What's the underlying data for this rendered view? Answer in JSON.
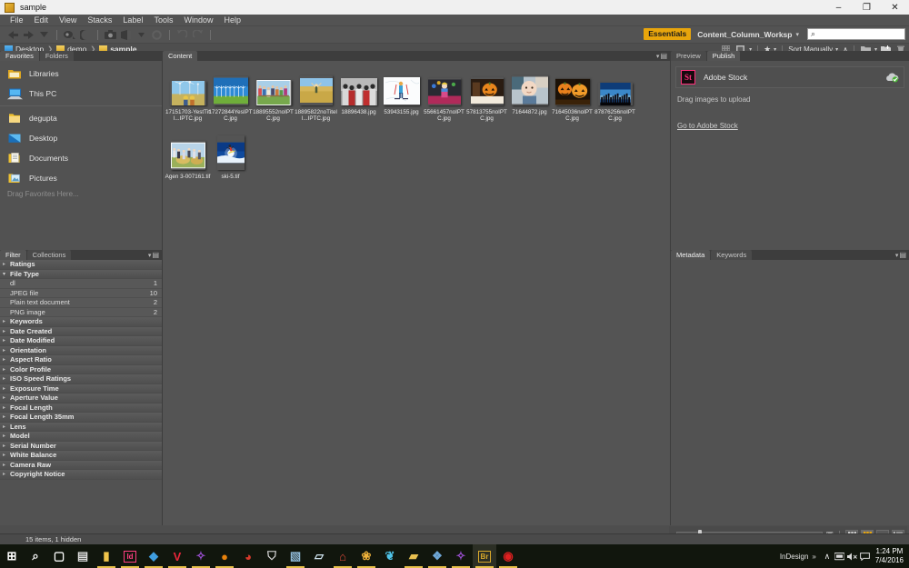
{
  "window": {
    "title": "sample",
    "app_icon": "bridge-app-icon",
    "minimize": "–",
    "maximize": "❐",
    "close": "✕"
  },
  "menubar": {
    "items": [
      "File",
      "Edit",
      "View",
      "Stacks",
      "Label",
      "Tools",
      "Window",
      "Help"
    ]
  },
  "toolbar": {
    "icons": [
      {
        "name": "back-arrow-icon",
        "glyph": "◀"
      },
      {
        "name": "forward-arrow-icon",
        "glyph": "▶"
      },
      {
        "name": "recent-dropdown-icon",
        "glyph": "▼"
      },
      {
        "name": "boomerang-reveal-icon",
        "glyph": "◔"
      },
      {
        "name": "refine-icon",
        "glyph": "☾"
      },
      {
        "name": "camera-import-icon",
        "glyph": "▣"
      },
      {
        "name": "open-in-camera-raw-icon",
        "glyph": "◧"
      },
      {
        "name": "refresh-icon",
        "glyph": "↻"
      },
      {
        "name": "rotate-ccw-icon",
        "glyph": "↶"
      },
      {
        "name": "rotate-cw-icon",
        "glyph": "↷"
      }
    ],
    "workspace_chip": "Essentials",
    "workspace_name": "Content_Column_Worksp",
    "workspace_caret": "▾",
    "search_placeholder": "",
    "search_value": "",
    "search_icon": "⌕"
  },
  "pathbar": {
    "crumbs": [
      {
        "label": "Desktop",
        "icon": "desktop-folder-icon"
      },
      {
        "label": "demo",
        "icon": "folder-icon"
      },
      {
        "label": "sample",
        "icon": "folder-icon"
      }
    ],
    "separator": "❯",
    "sort_label": "Sort Manually",
    "sort_caret": "▾",
    "sort_direction": "∧",
    "star_label": "★",
    "new_folder": "▤",
    "delete": "Ὕ1"
  },
  "favorites": {
    "tabs": [
      {
        "label": "Favorites",
        "active": true
      },
      {
        "label": "Folders",
        "active": false
      }
    ],
    "group_a": [
      {
        "label": "Libraries",
        "icon": "libraries-icon"
      },
      {
        "label": "This PC",
        "icon": "this-pc-icon"
      }
    ],
    "group_b": [
      {
        "label": "degupta",
        "icon": "user-folder-icon"
      },
      {
        "label": "Desktop",
        "icon": "desktop-icon"
      },
      {
        "label": "Documents",
        "icon": "documents-icon"
      },
      {
        "label": "Pictures",
        "icon": "pictures-icon"
      }
    ],
    "hint": "Drag Favorites Here..."
  },
  "filter": {
    "tabs": [
      {
        "label": "Filter",
        "active": true
      },
      {
        "label": "Collections",
        "active": false
      }
    ],
    "rows": [
      {
        "label": "Ratings",
        "expanded": false
      },
      {
        "label": "File Type",
        "expanded": true
      },
      {
        "label": "Keywords",
        "expanded": false
      },
      {
        "label": "Date Created",
        "expanded": false
      },
      {
        "label": "Date Modified",
        "expanded": false
      },
      {
        "label": "Orientation",
        "expanded": false
      },
      {
        "label": "Aspect Ratio",
        "expanded": false
      },
      {
        "label": "Color Profile",
        "expanded": false
      },
      {
        "label": "ISO Speed Ratings",
        "expanded": false
      },
      {
        "label": "Exposure Time",
        "expanded": false
      },
      {
        "label": "Aperture Value",
        "expanded": false
      },
      {
        "label": "Focal Length",
        "expanded": false
      },
      {
        "label": "Focal Length 35mm",
        "expanded": false
      },
      {
        "label": "Lens",
        "expanded": false
      },
      {
        "label": "Model",
        "expanded": false
      },
      {
        "label": "Serial Number",
        "expanded": false
      },
      {
        "label": "White Balance",
        "expanded": false
      },
      {
        "label": "Camera Raw",
        "expanded": false
      },
      {
        "label": "Copyright Notice",
        "expanded": false
      }
    ],
    "file_type_values": [
      {
        "label": "dl",
        "count": "1"
      },
      {
        "label": "JPEG file",
        "count": "10"
      },
      {
        "label": "Plain text document",
        "count": "2"
      },
      {
        "label": "PNG image",
        "count": "2"
      }
    ]
  },
  "content": {
    "tabs": [
      {
        "label": "Content",
        "active": true
      }
    ],
    "items": [
      {
        "caption": "17151703-YestTitl...IPTC.jpg",
        "art": "windturbines"
      },
      {
        "caption": "17272844YesIPTC.jpg",
        "art": "turbinerow"
      },
      {
        "caption": "18895552noIPTC.jpg",
        "art": "groupbench"
      },
      {
        "caption": "18895822noTitell...IPTC.jpg",
        "art": "wheatfield"
      },
      {
        "caption": "18896438.jpg",
        "art": "teamhuddle"
      },
      {
        "caption": "53943155.jpg",
        "art": "skierwhite"
      },
      {
        "caption": "55661457noIPTC.jpg",
        "art": "clown"
      },
      {
        "caption": "57813755noIPTC.jpg",
        "art": "pumpkin"
      },
      {
        "caption": "71644872.jpg",
        "art": "baby"
      },
      {
        "caption": "71645036noIPTC.jpg",
        "art": "pumpkins"
      },
      {
        "caption": "87876256noIPTC.jpg",
        "art": "skyline"
      },
      {
        "caption": "Agen 3-007161.tif",
        "art": "haystack"
      },
      {
        "caption": "ski-5.tif",
        "art": "snowboard"
      }
    ]
  },
  "preview": {
    "tabs": [
      {
        "label": "Preview",
        "active": false
      },
      {
        "label": "Publish",
        "active": true
      }
    ],
    "stock_logo": "St",
    "stock_name": "Adobe Stock",
    "cloud_icon": "cloud-synced-icon",
    "drag_hint": "Drag images to upload",
    "link": "Go to Adobe Stock"
  },
  "metadata": {
    "tabs": [
      {
        "label": "Metadata",
        "active": true
      },
      {
        "label": "Keywords",
        "active": false
      }
    ]
  },
  "statusbar": {
    "text": "15 items, 1 hidden",
    "zoom_small": "▫",
    "zoom_large": "▣",
    "views": [
      {
        "name": "grid-view",
        "glyph": "▦",
        "active": false
      },
      {
        "name": "thumbnail-view",
        "glyph": "▒",
        "active": true
      },
      {
        "name": "details-view",
        "glyph": "▬",
        "active": false
      },
      {
        "name": "list-view",
        "glyph": "≣",
        "active": false
      }
    ]
  },
  "taskbar": {
    "items": [
      {
        "name": "start-button",
        "glyph": "⊞",
        "color": "#ffffff",
        "running": false
      },
      {
        "name": "search-icon",
        "glyph": "⌕",
        "color": "#ffffff",
        "running": false
      },
      {
        "name": "task-view-icon",
        "glyph": "▢",
        "color": "#ffffff",
        "running": false
      },
      {
        "name": "cmd-prompt-icon",
        "glyph": "▤",
        "color": "#dddddd",
        "running": false
      },
      {
        "name": "file-explorer-icon",
        "glyph": "▮",
        "color": "#f0c44a",
        "running": true
      },
      {
        "name": "indesign-icon",
        "glyph": "Id",
        "color": "#ff3e81",
        "running": true
      },
      {
        "name": "gem-app-icon",
        "glyph": "◆",
        "color": "#3f9ee0",
        "running": true
      },
      {
        "name": "vivaldi-icon",
        "glyph": "V",
        "color": "#e8263a",
        "running": true
      },
      {
        "name": "visual-studio-icon",
        "glyph": "✧",
        "color": "#9b4fd1",
        "running": true
      },
      {
        "name": "firefox-icon",
        "glyph": "●",
        "color": "#e8820c",
        "running": true
      },
      {
        "name": "app-red-icon",
        "glyph": "◕",
        "color": "#d83a2c",
        "running": false
      },
      {
        "name": "user-account-icon",
        "glyph": "⛉",
        "color": "#d8d8d8",
        "running": false
      },
      {
        "name": "preview-app-icon",
        "glyph": "▧",
        "color": "#8fb9d6",
        "running": true
      },
      {
        "name": "notes-app-icon",
        "glyph": "▱",
        "color": "#cfe4ef",
        "running": false
      },
      {
        "name": "home-app-icon",
        "glyph": "⌂",
        "color": "#e24b3c",
        "running": true
      },
      {
        "name": "paint-app-icon",
        "glyph": "❀",
        "color": "#efb23a",
        "running": true
      },
      {
        "name": "blue-app-icon",
        "glyph": "❦",
        "color": "#4fc3e8",
        "running": false
      },
      {
        "name": "folder-app-icon",
        "glyph": "▰",
        "color": "#e8c050",
        "running": true
      },
      {
        "name": "remote-desktop-icon",
        "glyph": "❖",
        "color": "#6fa8d8",
        "running": true
      },
      {
        "name": "vs-code-icon",
        "glyph": "✧",
        "color": "#9b4fd1",
        "running": true
      },
      {
        "name": "bridge-icon",
        "glyph": "Br",
        "color": "#d8a82a",
        "running": true,
        "highlight": true
      },
      {
        "name": "adobe-red-icon",
        "glyph": "◉",
        "color": "#e02020",
        "running": true
      }
    ],
    "tray_app": "InDesign",
    "tray_overflow": "»",
    "tray_chevron": "∧",
    "tray_icons": [
      {
        "name": "network-icon",
        "glyph": "▣"
      },
      {
        "name": "volume-muted-icon",
        "glyph": "◁×"
      },
      {
        "name": "action-center-icon",
        "glyph": "▤"
      }
    ],
    "time": "1:24 PM",
    "date": "7/4/2016"
  }
}
